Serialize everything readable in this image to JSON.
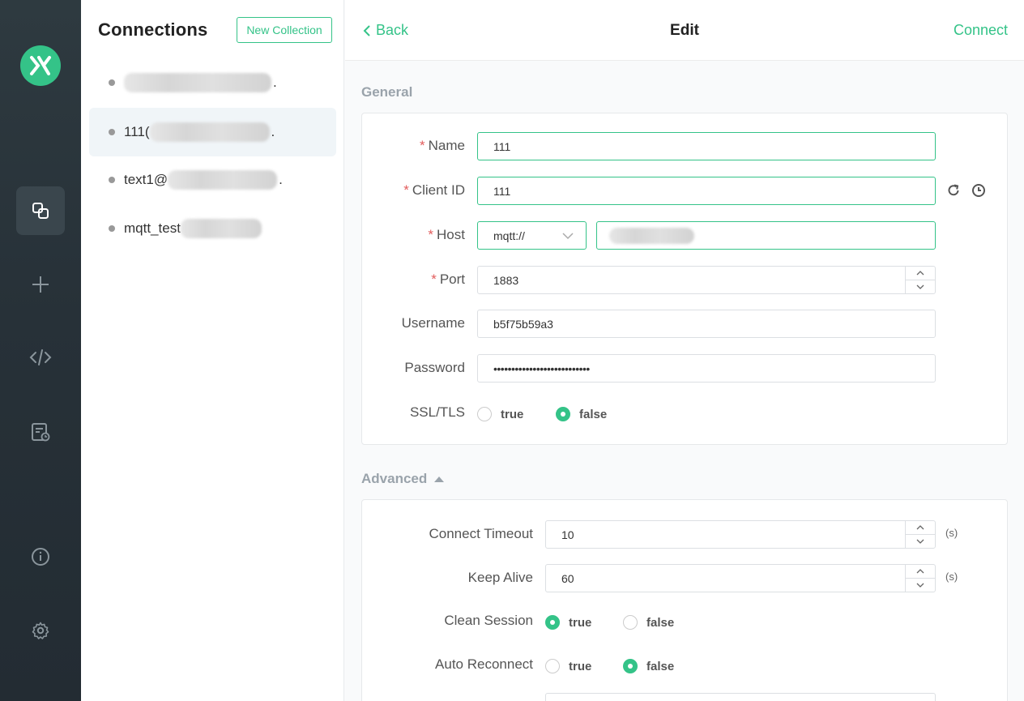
{
  "theme": {
    "accent": "#34c388",
    "rail_bg": "#2a343a",
    "required": "#e25c5c"
  },
  "rail": {
    "icons": [
      "connections-icon",
      "plus-icon",
      "code-icon",
      "log-icon",
      "info-icon",
      "gear-icon"
    ]
  },
  "sidebar": {
    "title": "Connections",
    "new_collection": "New Collection",
    "items": [
      {
        "label": "",
        "tail": "."
      },
      {
        "label": "111(",
        "tail": "."
      },
      {
        "label": "text1@",
        "tail": "."
      },
      {
        "label": "mqtt_test",
        "tail": ""
      }
    ]
  },
  "header": {
    "back": "Back",
    "title": "Edit",
    "connect": "Connect"
  },
  "general": {
    "title": "General",
    "name": {
      "label": "Name",
      "value": "111"
    },
    "client_id": {
      "label": "Client ID",
      "value": "111"
    },
    "host": {
      "label": "Host",
      "protocol": "mqtt://",
      "value": ""
    },
    "port": {
      "label": "Port",
      "value": "1883"
    },
    "username": {
      "label": "Username",
      "value": "b5f75b59a3"
    },
    "password": {
      "label": "Password",
      "value": "•••••••••••••••••••••••••••"
    },
    "ssl": {
      "label": "SSL/TLS",
      "true_label": "true",
      "false_label": "false",
      "selected": "false"
    }
  },
  "advanced": {
    "title": "Advanced",
    "connect_timeout": {
      "label": "Connect Timeout",
      "value": "10",
      "unit": "(s)"
    },
    "keep_alive": {
      "label": "Keep Alive",
      "value": "60",
      "unit": "(s)"
    },
    "clean_session": {
      "label": "Clean Session",
      "true_label": "true",
      "false_label": "false",
      "selected": "true"
    },
    "auto_reconnect": {
      "label": "Auto Reconnect",
      "true_label": "true",
      "false_label": "false",
      "selected": "false"
    }
  }
}
